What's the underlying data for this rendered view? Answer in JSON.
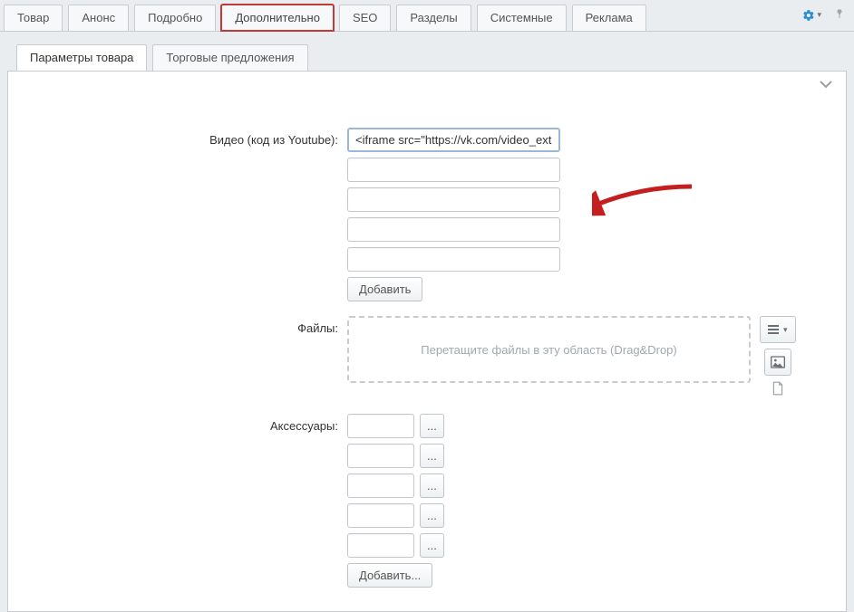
{
  "topTabs": {
    "items": [
      {
        "label": "Товар"
      },
      {
        "label": "Анонс"
      },
      {
        "label": "Подробно"
      },
      {
        "label": "Дополнительно"
      },
      {
        "label": "SEO"
      },
      {
        "label": "Разделы"
      },
      {
        "label": "Системные"
      },
      {
        "label": "Реклама"
      }
    ]
  },
  "subTabs": {
    "items": [
      {
        "label": "Параметры товара"
      },
      {
        "label": "Торговые предложения"
      }
    ]
  },
  "form": {
    "video": {
      "label": "Видео (код из Youtube):",
      "values": [
        "<iframe src=\"https://vk.com/video_ext.php",
        "",
        "",
        "",
        ""
      ],
      "add_button": "Добавить"
    },
    "files": {
      "label": "Файлы:",
      "dropzone_text": "Перетащите файлы в эту область (Drag&Drop)"
    },
    "accessories": {
      "label": "Аксессуары:",
      "values": [
        "",
        "",
        "",
        "",
        ""
      ],
      "browse_button": "...",
      "add_button": "Добавить..."
    }
  }
}
